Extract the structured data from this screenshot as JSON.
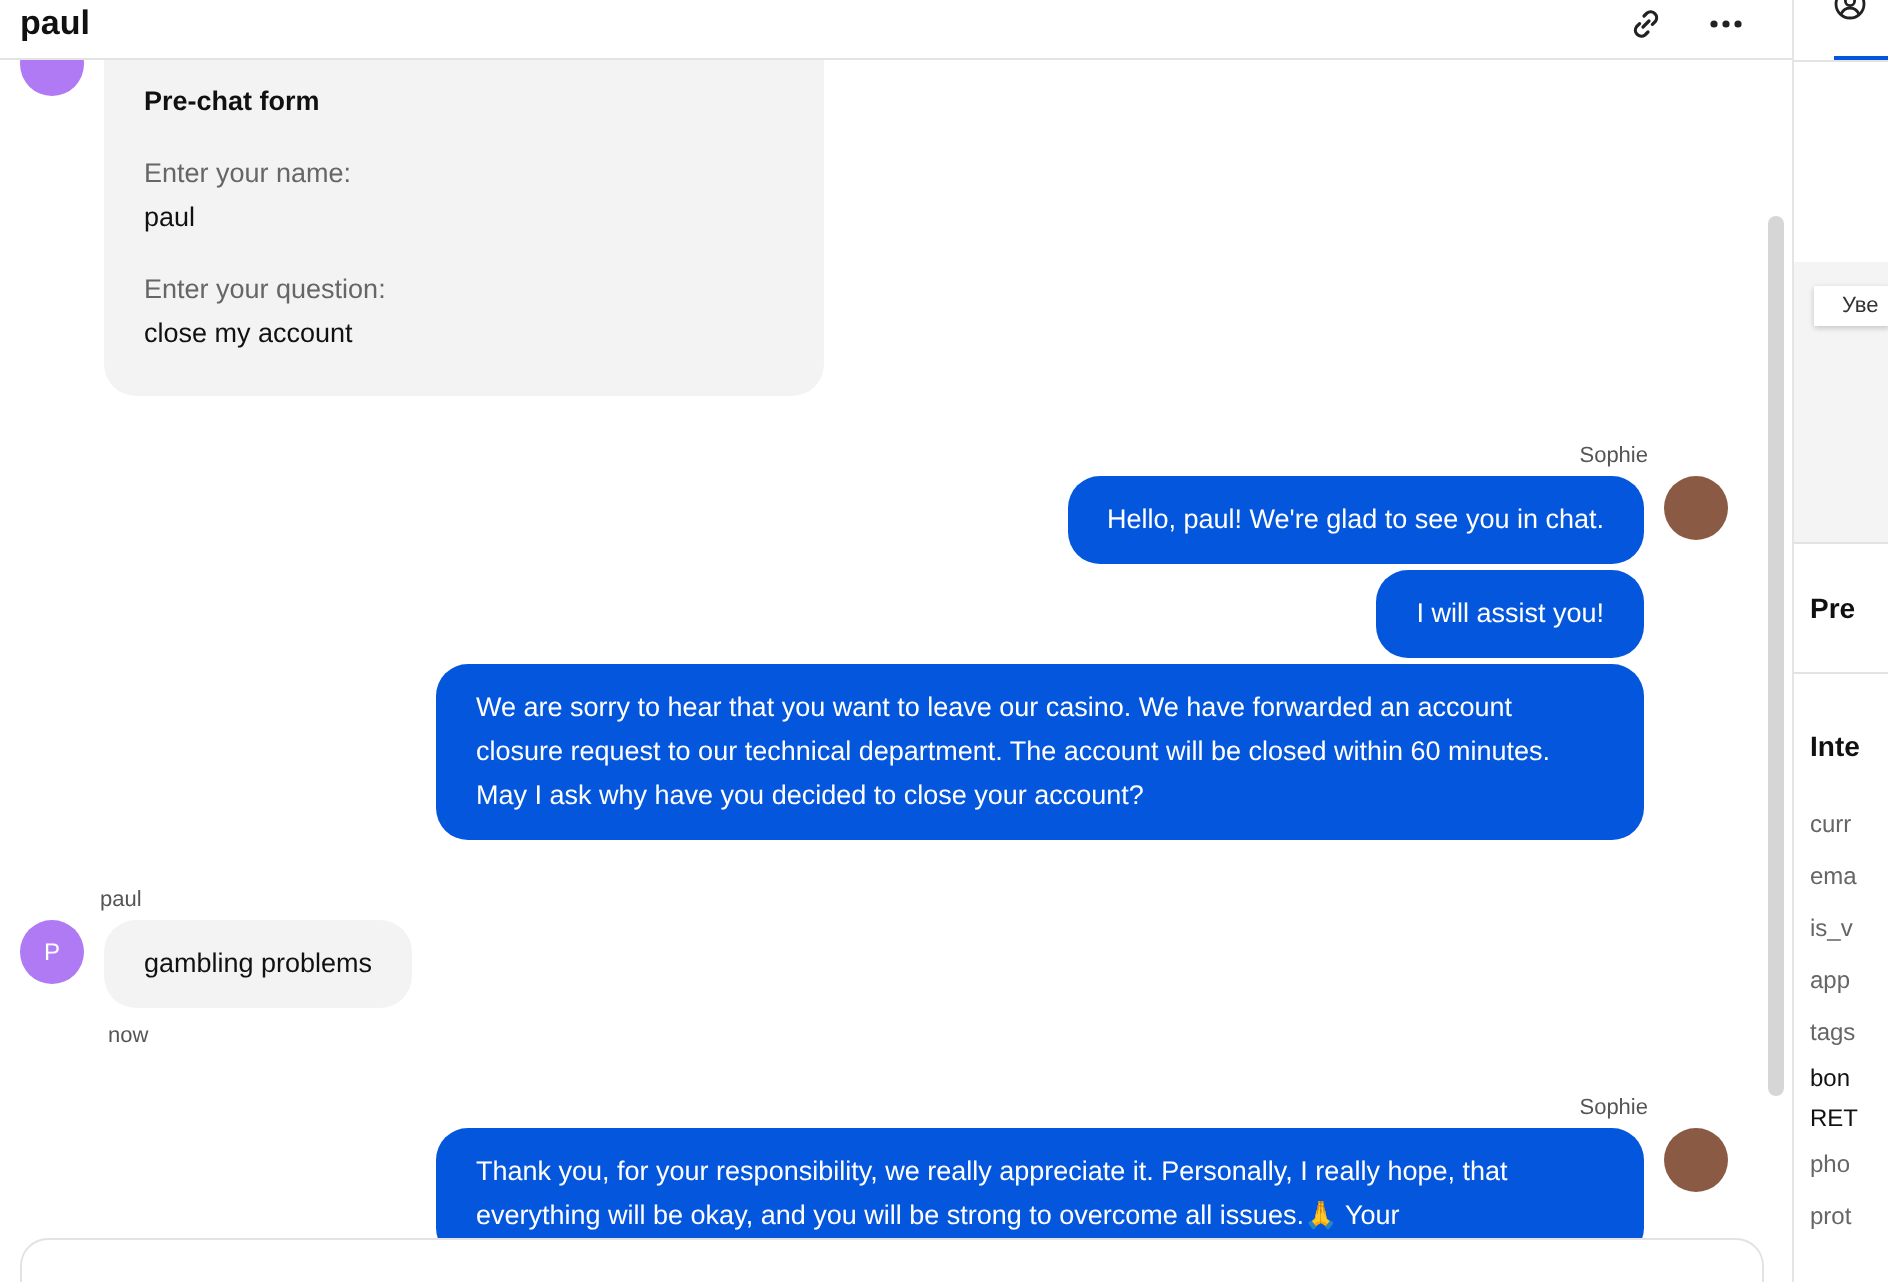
{
  "header": {
    "title": "paul"
  },
  "groups": [
    {
      "kind": "incoming",
      "bubbles": [
        {
          "kind": "form",
          "title": "Pre-chat form",
          "fields": [
            {
              "label": "Enter your name:",
              "value": "paul"
            },
            {
              "label": "Enter your question:",
              "value": "close my account"
            }
          ]
        }
      ]
    },
    {
      "kind": "outgoing",
      "sender": "Sophie",
      "bubbles": [
        {
          "kind": "text",
          "text": "Hello, paul! We're glad to see you in chat."
        },
        {
          "kind": "text",
          "text": "I will assist you!"
        },
        {
          "kind": "text",
          "text": "We are sorry to hear that you want to leave our casino. We have forwarded an account closure request to our technical department. The account will be closed within 60 minutes. May I ask why have you decided to close your account?"
        }
      ]
    },
    {
      "kind": "incoming",
      "sender": "paul",
      "avatar": "P",
      "time": "now",
      "bubbles": [
        {
          "kind": "text",
          "text": "gambling problems"
        }
      ]
    },
    {
      "kind": "outgoing",
      "sender": "Sophie",
      "bubbles": [
        {
          "kind": "text",
          "text": "Thank you, for your responsibility, we really appreciate it. Personally, I really hope, that everything will be okay, and you will be strong to overcome all issues.🙏 Your"
        }
      ]
    }
  ],
  "side_panel": {
    "tab_selected": true,
    "map_button": "Уве",
    "section_1": "Pre",
    "section_2": "Inte",
    "items": [
      {
        "kind": "key",
        "text": "curr"
      },
      {
        "kind": "key",
        "text": "ema"
      },
      {
        "kind": "key",
        "text": "is_v"
      },
      {
        "kind": "key",
        "text": "app"
      },
      {
        "kind": "key",
        "text": "tags"
      },
      {
        "kind": "value",
        "text": "bon"
      },
      {
        "kind": "value",
        "text": "RET"
      },
      {
        "kind": "key",
        "text": "pho"
      },
      {
        "kind": "key",
        "text": "prot"
      }
    ]
  }
}
